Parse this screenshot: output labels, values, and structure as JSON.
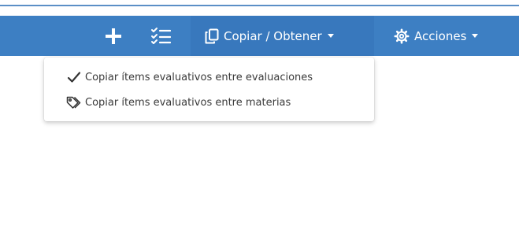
{
  "toolbar": {
    "add_icon": "plus-icon",
    "checklist_icon": "checklist-icon",
    "copy_button": {
      "icon": "copy-icon",
      "label": "Copiar / Obtener"
    },
    "actions_button": {
      "icon": "gear-icon",
      "label": "Acciones"
    },
    "background_color": "#3d7fc3"
  },
  "copy_menu": {
    "items": [
      {
        "icon": "checkmark-icon",
        "label": "Copiar ítems evaluativos entre evaluaciones"
      },
      {
        "icon": "tags-icon",
        "label": "Copiar ítems evaluativos entre materias"
      }
    ]
  }
}
